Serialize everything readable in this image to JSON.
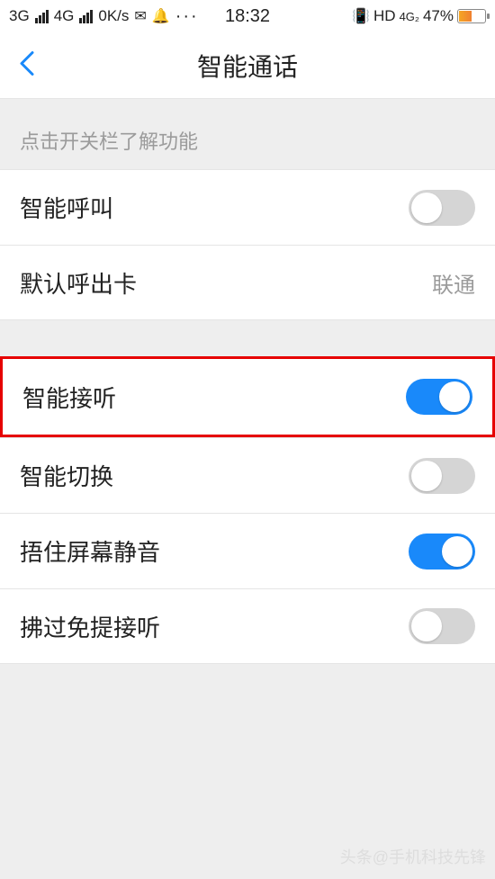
{
  "status": {
    "net1": "3G",
    "net2": "4G",
    "speed": "0K/s",
    "time": "18:32",
    "hd": "HD",
    "net_badge": "4G₂",
    "battery_pct": "47%"
  },
  "header": {
    "title": "智能通话"
  },
  "hint": "点击开关栏了解功能",
  "rows": {
    "smart_call": {
      "label": "智能呼叫",
      "on": false
    },
    "default_sim": {
      "label": "默认呼出卡",
      "value": "联通"
    },
    "smart_answer": {
      "label": "智能接听",
      "on": true
    },
    "smart_switch": {
      "label": "智能切换",
      "on": false
    },
    "cover_mute": {
      "label": "捂住屏幕静音",
      "on": true
    },
    "wave_answer": {
      "label": "拂过免提接听",
      "on": false
    }
  },
  "watermark": "头条@手机科技先锋"
}
